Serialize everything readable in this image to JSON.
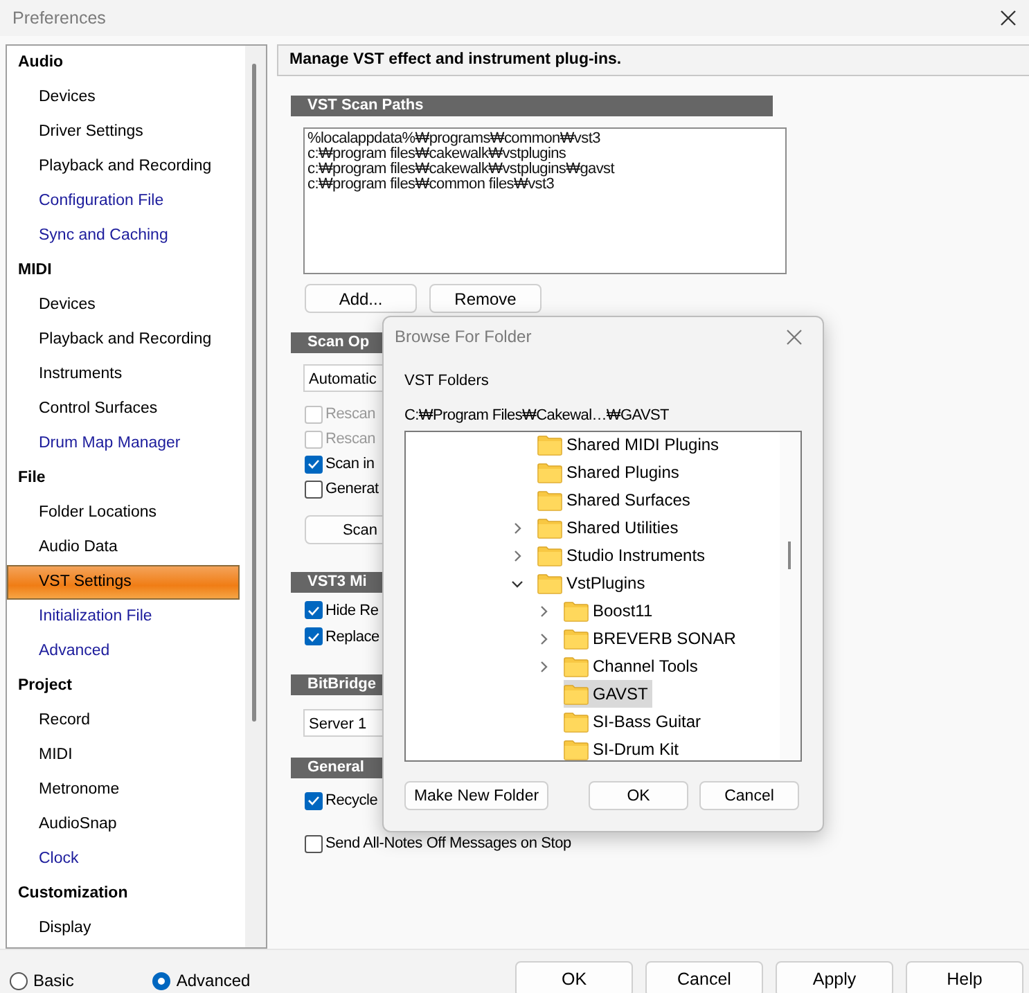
{
  "window": {
    "title": "Preferences"
  },
  "sidebar": {
    "groups": [
      {
        "label": "Audio",
        "items": [
          {
            "label": "Devices",
            "selected": false,
            "kind": "page"
          },
          {
            "label": "Driver Settings",
            "selected": false,
            "kind": "page"
          },
          {
            "label": "Playback and Recording",
            "selected": false,
            "kind": "page"
          },
          {
            "label": "Configuration File",
            "selected": false,
            "kind": "link"
          },
          {
            "label": "Sync and Caching",
            "selected": false,
            "kind": "link"
          }
        ]
      },
      {
        "label": "MIDI",
        "items": [
          {
            "label": "Devices",
            "selected": false,
            "kind": "page"
          },
          {
            "label": "Playback and Recording",
            "selected": false,
            "kind": "page"
          },
          {
            "label": "Instruments",
            "selected": false,
            "kind": "page"
          },
          {
            "label": "Control Surfaces",
            "selected": false,
            "kind": "page"
          },
          {
            "label": "Drum Map Manager",
            "selected": false,
            "kind": "link"
          }
        ]
      },
      {
        "label": "File",
        "items": [
          {
            "label": "Folder Locations",
            "selected": false,
            "kind": "page"
          },
          {
            "label": "Audio Data",
            "selected": false,
            "kind": "page"
          },
          {
            "label": "VST Settings",
            "selected": true,
            "kind": "page"
          },
          {
            "label": "Initialization File",
            "selected": false,
            "kind": "link"
          },
          {
            "label": "Advanced",
            "selected": false,
            "kind": "link"
          }
        ]
      },
      {
        "label": "Project",
        "items": [
          {
            "label": "Record",
            "selected": false,
            "kind": "page"
          },
          {
            "label": "MIDI",
            "selected": false,
            "kind": "page"
          },
          {
            "label": "Metronome",
            "selected": false,
            "kind": "page"
          },
          {
            "label": "AudioSnap",
            "selected": false,
            "kind": "page"
          },
          {
            "label": "Clock",
            "selected": false,
            "kind": "link"
          }
        ]
      },
      {
        "label": "Customization",
        "items": [
          {
            "label": "Display",
            "selected": false,
            "kind": "page"
          }
        ]
      }
    ]
  },
  "mode_options": [
    {
      "label": "Basic",
      "selected": false
    },
    {
      "label": "Advanced",
      "selected": true
    }
  ],
  "buttons": [
    "OK",
    "Cancel",
    "Apply",
    "Help"
  ],
  "panel": {
    "description": "Manage VST effect and instrument plug-ins.",
    "sections": [
      {
        "title": "VST Scan Paths",
        "controls": [
          {
            "kind": "pathlist",
            "lines": [
              "%localappdata%₩programs₩common₩vst3",
              "c:₩program files₩cakewalk₩vstplugins",
              "c:₩program files₩cakewalk₩vstplugins₩gavst",
              "c:₩program files₩common files₩vst3"
            ]
          },
          {
            "kind": "buttons",
            "labels": [
              "Add...",
              "Remove"
            ]
          }
        ]
      },
      {
        "title": "Scan Op",
        "controls": [
          {
            "kind": "dropdown",
            "value": "Automatic"
          },
          {
            "kind": "checkbox",
            "label": "Rescan",
            "checked": false,
            "disabled": true
          },
          {
            "kind": "checkbox",
            "label": "Rescan",
            "checked": false,
            "disabled": true
          },
          {
            "kind": "checkbox",
            "label": "Scan in",
            "checked": true,
            "disabled": false
          },
          {
            "kind": "checkbox",
            "label": "Generat",
            "checked": false,
            "disabled": false
          },
          {
            "kind": "button",
            "label": "Scan"
          }
        ]
      },
      {
        "title": "VST3 Mi",
        "controls": [
          {
            "kind": "checkbox",
            "label": "Hide Re",
            "checked": true,
            "disabled": false
          },
          {
            "kind": "checkbox",
            "label": "Replace",
            "checked": true,
            "disabled": false
          }
        ]
      },
      {
        "title": "BitBridge",
        "controls": [
          {
            "kind": "dropdown",
            "value": "Server 1"
          }
        ]
      },
      {
        "title": "General",
        "controls": [
          {
            "kind": "checkbox",
            "label": "Recycle",
            "checked": true,
            "disabled": false
          },
          {
            "kind": "checkbox",
            "label": "Send All-Notes Off Messages on Stop",
            "checked": false,
            "disabled": false
          }
        ]
      }
    ]
  },
  "dialog": {
    "title": "Browse For Folder",
    "prompt": "VST Folders",
    "path": "C:₩Program Files₩Cakewal…₩GAVST",
    "tree": [
      {
        "label": "Shared MIDI Plugins",
        "kind": "leaf",
        "selected": false
      },
      {
        "label": "Shared Plugins",
        "kind": "leaf",
        "selected": false
      },
      {
        "label": "Shared Surfaces",
        "kind": "leaf",
        "selected": false
      },
      {
        "label": "Shared Utilities",
        "kind": "collapsed",
        "selected": false
      },
      {
        "label": "Studio Instruments",
        "kind": "collapsed",
        "selected": false
      },
      {
        "label": "VstPlugins",
        "kind": "expanded",
        "selected": false,
        "children": [
          {
            "label": "Boost11",
            "kind": "collapsed",
            "selected": false
          },
          {
            "label": "BREVERB SONAR",
            "kind": "collapsed",
            "selected": false
          },
          {
            "label": "Channel Tools",
            "kind": "collapsed",
            "selected": false
          },
          {
            "label": "GAVST",
            "kind": "leaf",
            "selected": true
          },
          {
            "label": "SI-Bass Guitar",
            "kind": "leaf",
            "selected": false
          },
          {
            "label": "SI-Drum Kit",
            "kind": "leaf",
            "selected": false
          }
        ]
      }
    ],
    "buttons": [
      "Make New Folder",
      "OK",
      "Cancel"
    ]
  }
}
